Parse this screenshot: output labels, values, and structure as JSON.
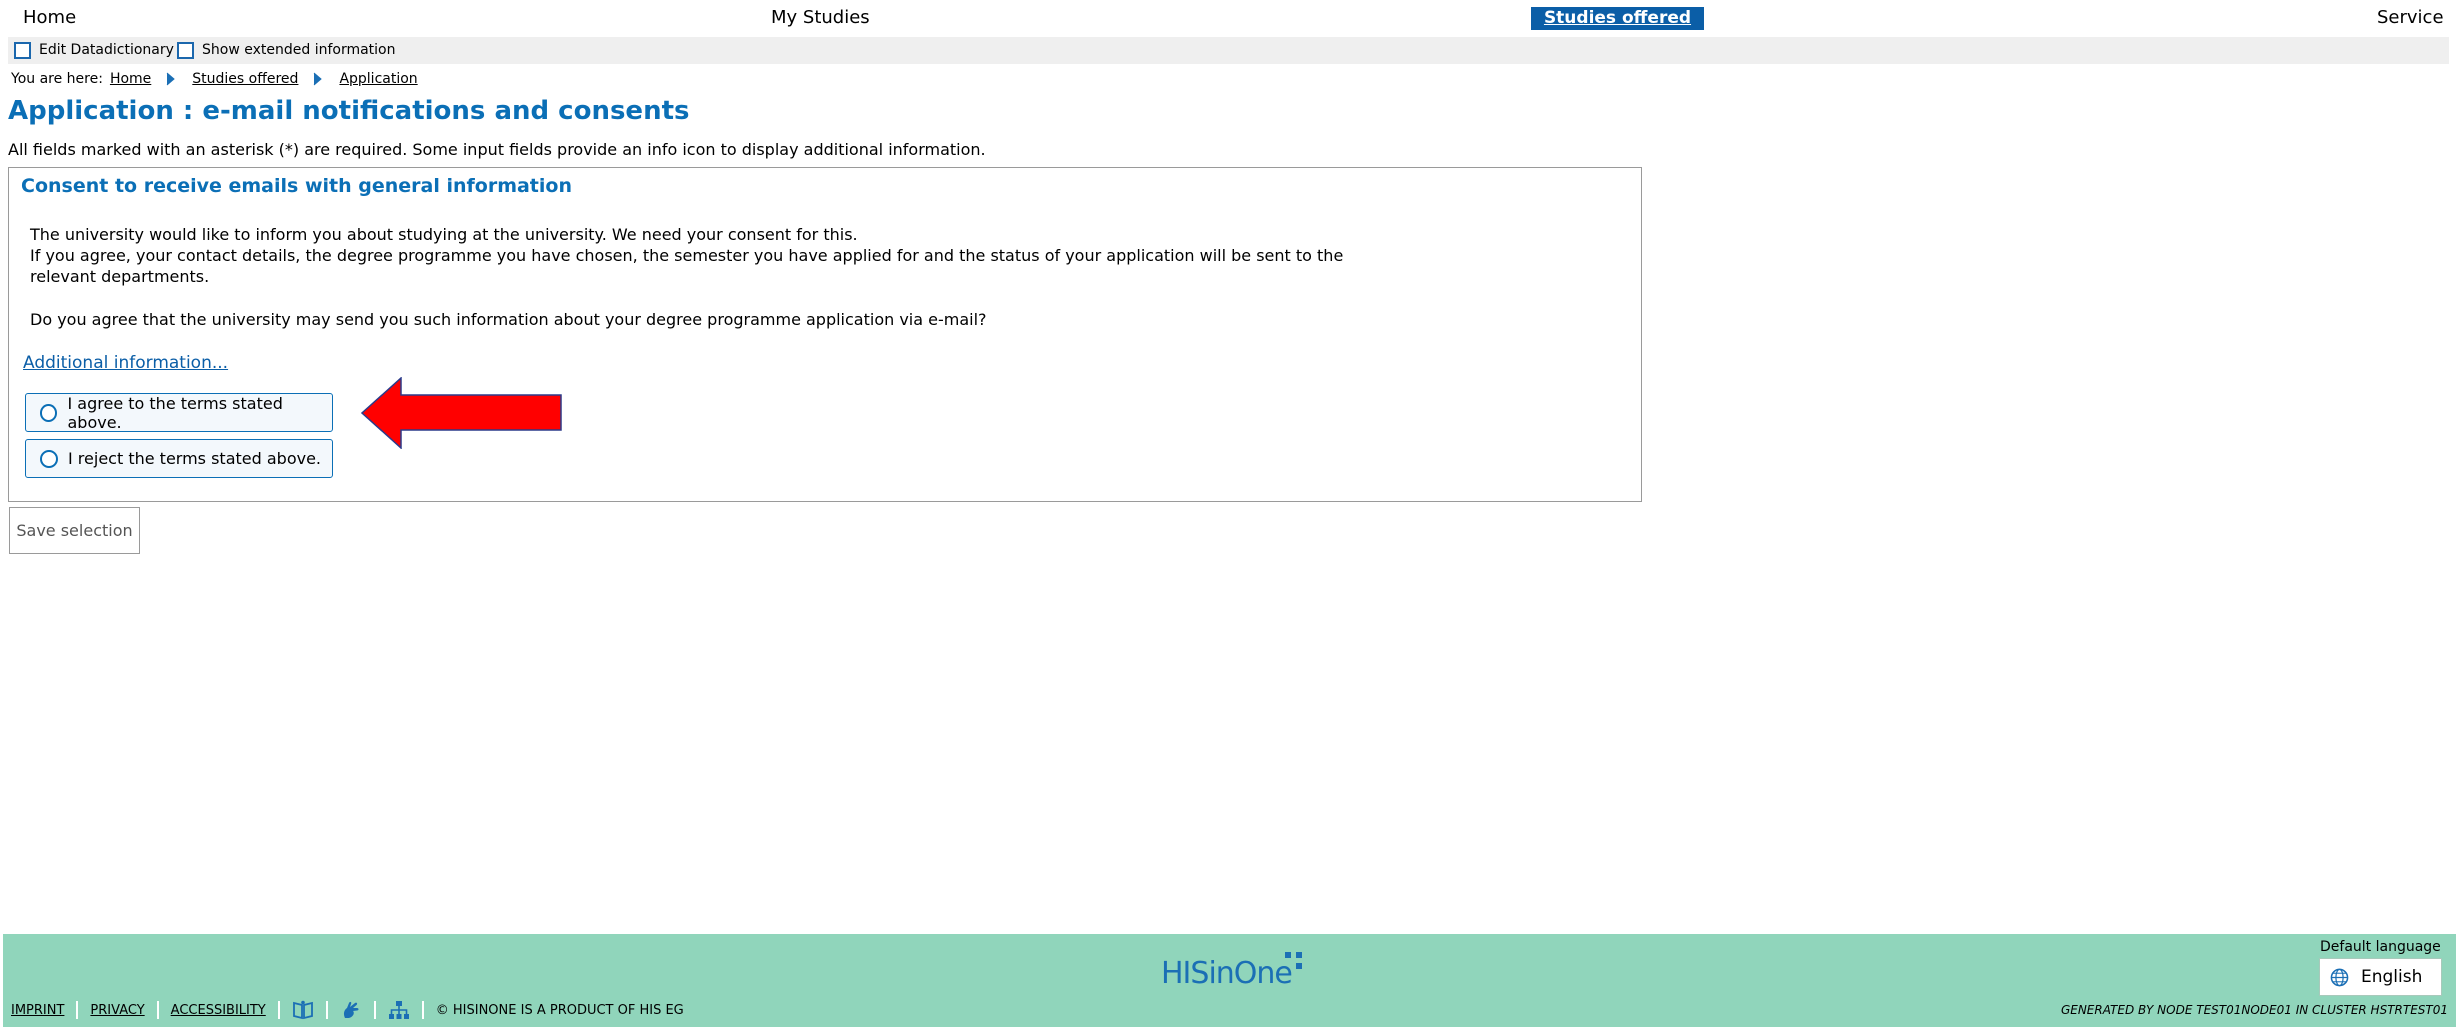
{
  "topnav": {
    "home": "Home",
    "my_studies": "My Studies",
    "studies_offered": "Studies offered",
    "service": "Service"
  },
  "options": {
    "edit_datadictionary": "Edit Datadictionary",
    "show_extended": "Show extended information"
  },
  "breadcrumb": {
    "lead": "You are here:",
    "items": [
      "Home",
      "Studies offered",
      "Application"
    ]
  },
  "page": {
    "title": "Application : e-mail notifications and consents",
    "required_note": "All fields marked with an asterisk (*) are required. Some input fields provide an info icon to display additional information."
  },
  "panel": {
    "title": "Consent to receive emails with general information",
    "text_line1": "The university would like to inform you about studying at the university. We need your consent for this.",
    "text_line2": "If you agree, your contact details, the degree programme you have chosen, the semester you have applied for and the status of your application will be sent to the relevant departments.",
    "question": "Do you agree that the university may send you such information about your degree programme application via e-mail?",
    "additional_info": "Additional information...",
    "option_agree": "I agree to the terms stated above.",
    "option_reject": "I reject the terms stated above."
  },
  "save_label": "Save selection",
  "footer": {
    "logo": "HISinOne",
    "lang_label": "Default language",
    "lang_value": "English",
    "links": [
      "IMPRINT",
      "PRIVACY",
      "ACCESSIBILITY"
    ],
    "copyright": "© HISINONE IS A PRODUCT OF HIS EG",
    "generated": "GENERATED BY NODE TEST01NODE01 IN CLUSTER HSTRTEST01"
  },
  "colors": {
    "accent": "#0b6fb6",
    "nav_active": "#0b5ea7",
    "footer_bg": "#90d5bb",
    "arrow": "#ff0000"
  },
  "icons": [
    "chevron-right-icon",
    "radio-unchecked-icon",
    "red-arrow-icon",
    "globe-icon",
    "book-icon",
    "sign-language-icon",
    "sitemap-icon"
  ]
}
